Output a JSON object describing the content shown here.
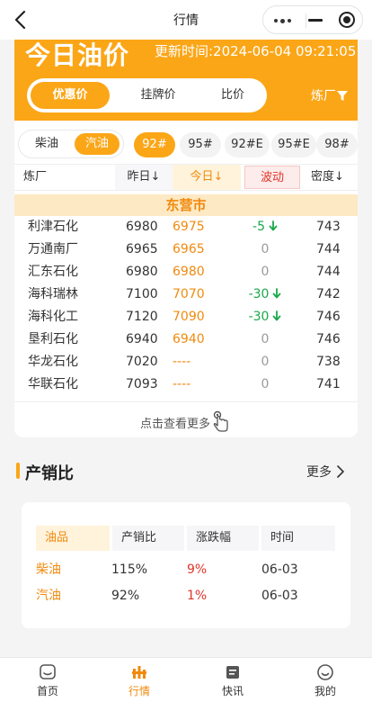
{
  "nav": {
    "title": "行情"
  },
  "header": {
    "title": "今日油价",
    "update_text": "更新时间:2024-06-04 09:21:05",
    "tabs": [
      {
        "label": "优惠价",
        "active": true
      },
      {
        "label": "挂牌价",
        "active": false
      },
      {
        "label": "比价",
        "active": false
      }
    ],
    "refinery_filter_label": "炼厂"
  },
  "fuel_types": [
    {
      "label": "柴油",
      "active": false
    },
    {
      "label": "汽油",
      "active": true
    }
  ],
  "grades": [
    {
      "label": "92#",
      "active": true
    },
    {
      "label": "95#",
      "active": false
    },
    {
      "label": "92#E",
      "active": false
    },
    {
      "label": "95#E",
      "active": false
    },
    {
      "label": "98#",
      "active": false
    }
  ],
  "table": {
    "headers": {
      "refinery": "炼厂",
      "yesterday": "昨日↓",
      "today": "今日↓",
      "change": "波动",
      "density": "密度↓"
    },
    "city": "东营市",
    "rows": [
      {
        "name": "利津石化",
        "yesterday": "6980",
        "today": "6975",
        "change": "-5",
        "dir": "down",
        "density": "743"
      },
      {
        "name": "万通南厂",
        "yesterday": "6965",
        "today": "6965",
        "change": "0",
        "dir": "flat",
        "density": "744"
      },
      {
        "name": "汇东石化",
        "yesterday": "6980",
        "today": "6980",
        "change": "0",
        "dir": "flat",
        "density": "744"
      },
      {
        "name": "海科瑞林",
        "yesterday": "7100",
        "today": "7070",
        "change": "-30",
        "dir": "down",
        "density": "742"
      },
      {
        "name": "海科化工",
        "yesterday": "7120",
        "today": "7090",
        "change": "-30",
        "dir": "down",
        "density": "746"
      },
      {
        "name": "垦利石化",
        "yesterday": "6940",
        "today": "6940",
        "change": "0",
        "dir": "flat",
        "density": "746"
      },
      {
        "name": "华龙石化",
        "yesterday": "7020",
        "today": "----",
        "change": "0",
        "dir": "flat",
        "density": "738"
      },
      {
        "name": "华联石化",
        "yesterday": "7093",
        "today": "----",
        "change": "0",
        "dir": "flat",
        "density": "741"
      }
    ],
    "see_more": "点击查看更多"
  },
  "sales_ratio": {
    "title": "产销比",
    "more_label": "更多",
    "headers": [
      "油品",
      "产销比",
      "涨跌幅",
      "时间"
    ],
    "rows": [
      {
        "product": "柴油",
        "ratio": "115%",
        "change": "9%",
        "time": "06-03"
      },
      {
        "product": "汽油",
        "ratio": "92%",
        "change": "1%",
        "time": "06-03"
      }
    ]
  },
  "tabbar": [
    {
      "label": "首页",
      "icon": "home-icon",
      "active": false
    },
    {
      "label": "行情",
      "icon": "market-icon",
      "active": true
    },
    {
      "label": "快讯",
      "icon": "news-icon",
      "active": false
    },
    {
      "label": "我的",
      "icon": "profile-icon",
      "active": false
    }
  ],
  "colors": {
    "accent": "#fba617",
    "accent_text": "#f08a0e",
    "down": "#19a84a",
    "up": "#e2352b"
  }
}
